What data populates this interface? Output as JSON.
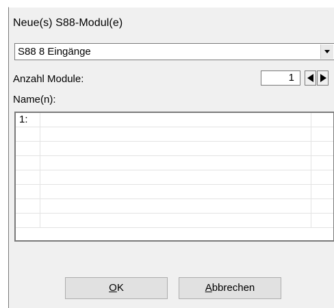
{
  "dialog": {
    "title": "Neue(s) S88-Modul(e)",
    "module_type": {
      "selected": "S88 8 Eingänge"
    },
    "count": {
      "label": "Anzahl Module:",
      "value": "1"
    },
    "names": {
      "label": "Name(n):",
      "rows": [
        {
          "num": "1:",
          "name": ""
        },
        {
          "num": "",
          "name": ""
        },
        {
          "num": "",
          "name": ""
        },
        {
          "num": "",
          "name": ""
        },
        {
          "num": "",
          "name": ""
        },
        {
          "num": "",
          "name": ""
        },
        {
          "num": "",
          "name": ""
        },
        {
          "num": "",
          "name": ""
        }
      ]
    },
    "buttons": {
      "ok_mnemonic": "O",
      "ok_rest": "K",
      "cancel_mnemonic": "A",
      "cancel_rest": "bbrechen"
    }
  },
  "icons": {
    "combo_arrow": "chevron-down-icon",
    "decrement": "arrow-left-icon",
    "increment": "arrow-right-icon"
  }
}
